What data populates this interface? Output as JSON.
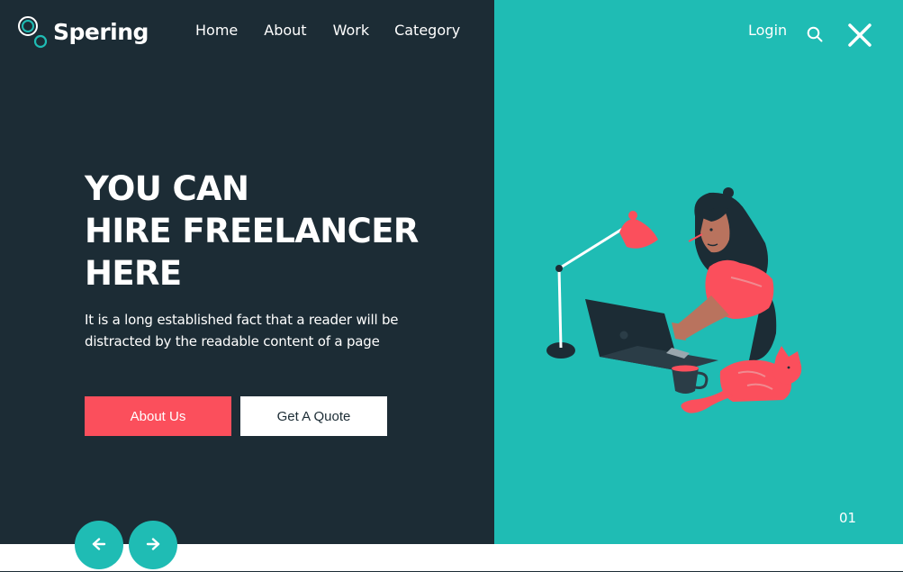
{
  "brand": {
    "name": "Spering"
  },
  "nav": {
    "items": [
      {
        "label": "Home"
      },
      {
        "label": "About"
      },
      {
        "label": "Work"
      },
      {
        "label": "Category"
      }
    ],
    "login_label": "Login"
  },
  "icons": {
    "logo": "logo-circles-icon",
    "search": "search-icon",
    "close": "close-icon",
    "prev": "arrow-left-icon",
    "next": "arrow-right-icon"
  },
  "hero": {
    "headline_line1": "YOU CAN",
    "headline_line2": "HIRE FREELANCER",
    "headline_line3": "HERE",
    "subtext_line1": "It is a long established fact that a reader will be",
    "subtext_line2": "distracted by the readable content of a page",
    "primary_button": "About Us",
    "secondary_button": "Get A Quote"
  },
  "slider": {
    "current": "01"
  },
  "colors": {
    "dark_panel": "#1c2c35",
    "teal_panel": "#1fbcb4",
    "accent_red": "#fb4f5c",
    "white": "#ffffff"
  }
}
